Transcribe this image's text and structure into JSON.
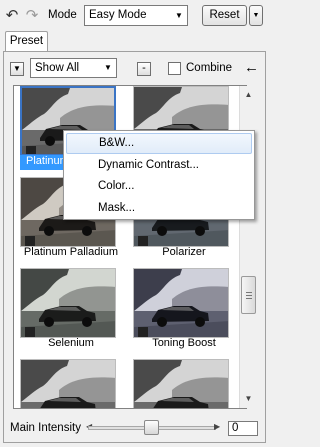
{
  "toolbar": {
    "undo_icon": "undo-arrow-icon",
    "redo_icon": "redo-arrow-icon",
    "mode_label": "Mode",
    "mode_value": "Easy Mode",
    "reset_label": "Reset"
  },
  "tabs": [
    {
      "label": "Preset",
      "active": true
    }
  ],
  "filter": {
    "menu_icon": "dropdown-icon",
    "selected": "Show All",
    "minus_label": "-",
    "combine_label": "Combine",
    "combine_checked": false,
    "back_icon": "left-arrow-icon"
  },
  "presets": [
    {
      "name": "Platinum",
      "tone": "bw",
      "selected": true
    },
    {
      "name": "",
      "tone": "bw",
      "selected": false
    },
    {
      "name": "Platinum Palladium",
      "tone": "warm",
      "selected": false
    },
    {
      "name": "Polarizer",
      "tone": "cool",
      "selected": false
    },
    {
      "name": "Selenium",
      "tone": "selenium",
      "selected": false
    },
    {
      "name": "Toning Boost",
      "tone": "boost",
      "selected": false
    },
    {
      "name": "",
      "tone": "bw",
      "selected": false
    },
    {
      "name": "",
      "tone": "bw",
      "selected": false
    }
  ],
  "context_menu": {
    "items": [
      {
        "label": "B&W...",
        "hover": true
      },
      {
        "label": "Dynamic Contrast...",
        "hover": false
      },
      {
        "label": "Color...",
        "hover": false
      },
      {
        "label": "Mask...",
        "hover": false
      }
    ]
  },
  "intensity": {
    "label": "Main Intensity",
    "value": "0"
  },
  "colors": {
    "selection": "#3399ff",
    "menu_hover_border": "#aecbf0"
  }
}
